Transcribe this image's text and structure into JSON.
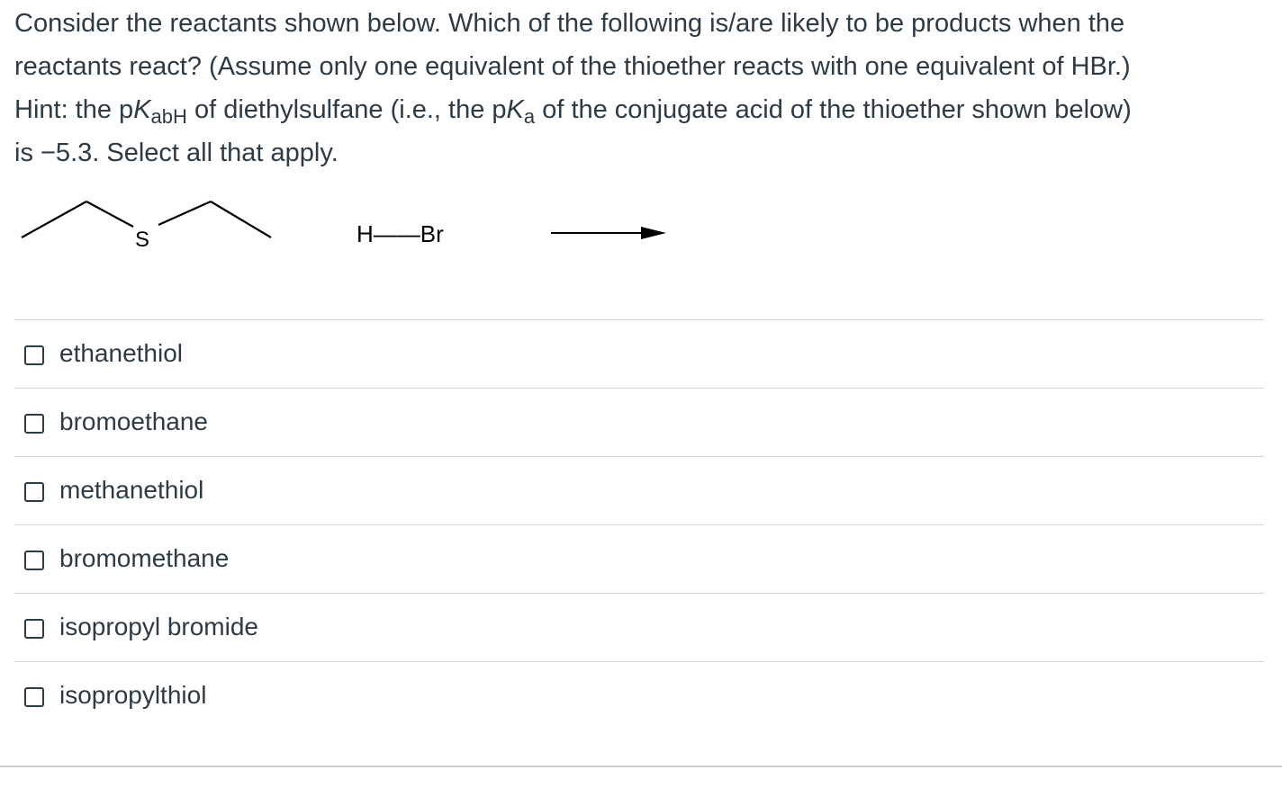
{
  "question": {
    "line1": "Consider the reactants shown below. Which of the following is/are likely to be products when the",
    "line2": "reactants react? (Assume only one equivalent of the thioether reacts with one equivalent of HBr.)",
    "hint_prefix": "Hint: the p",
    "K": "K",
    "sub_abH": "abH",
    "hint_mid": " of diethylsulfane (i.e., the p",
    "sub_a": "a",
    "hint_end": " of the conjugate acid of the thioether shown below)",
    "line4": "is −5.3. Select all that apply."
  },
  "reaction": {
    "sulfur_label": "S",
    "reagent_label": "H——Br"
  },
  "answers": [
    {
      "label": "ethanethiol",
      "checked": false
    },
    {
      "label": "bromoethane",
      "checked": false
    },
    {
      "label": "methanethiol",
      "checked": false
    },
    {
      "label": "bromomethane",
      "checked": false
    },
    {
      "label": "isopropyl bromide",
      "checked": false
    },
    {
      "label": "isopropylthiol",
      "checked": false
    }
  ]
}
